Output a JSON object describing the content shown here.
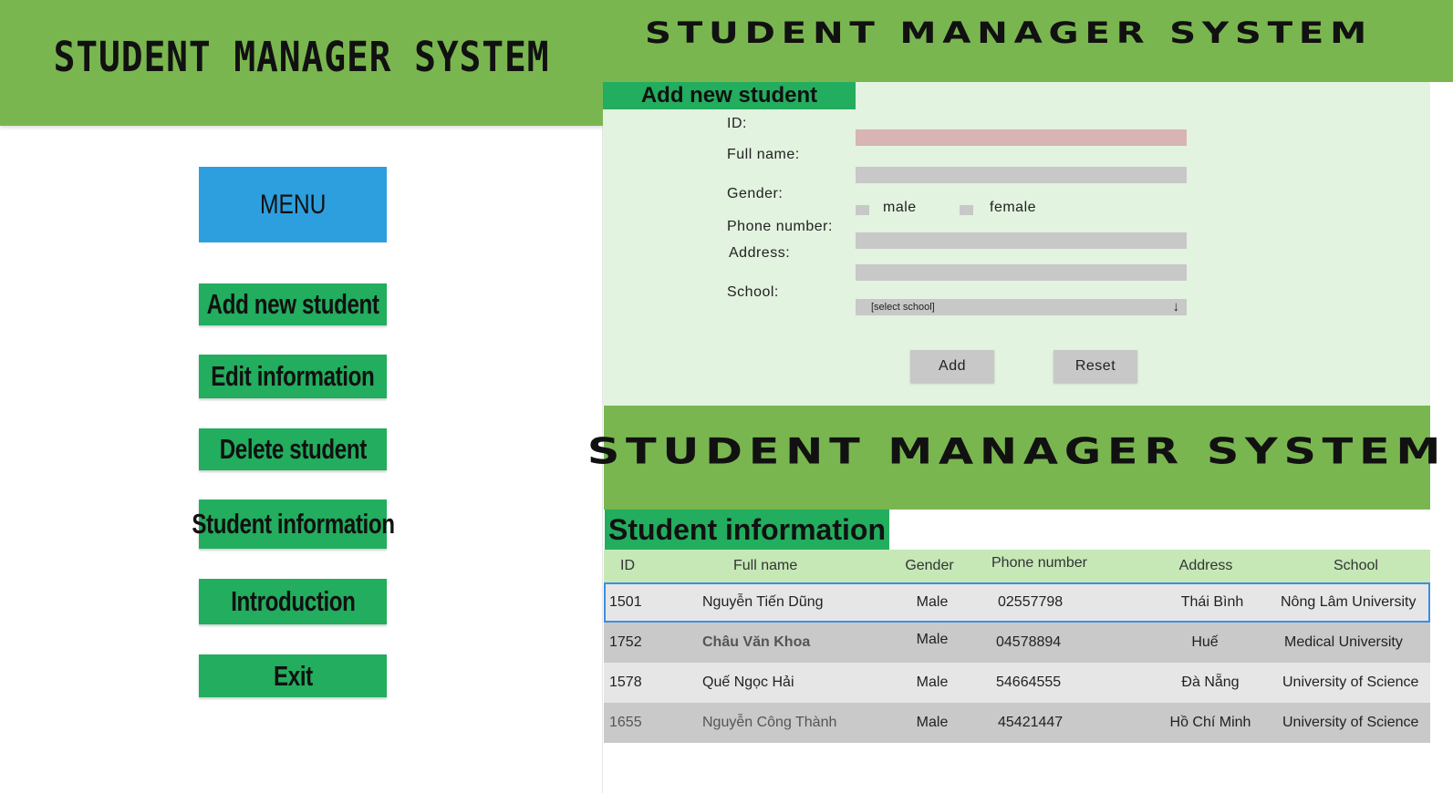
{
  "left": {
    "title": "STUDENT MANAGER SYSTEM",
    "menu_header": "MENU",
    "menu_items": [
      {
        "label": "Add new student"
      },
      {
        "label": "Edit information"
      },
      {
        "label": "Delete student"
      },
      {
        "label": "Student information"
      },
      {
        "label": "Introduction"
      },
      {
        "label": "Exit"
      }
    ]
  },
  "add_panel": {
    "title": "STUDENT MANAGER SYSTEM",
    "tab_label": "Add new student",
    "labels": {
      "id": "ID:",
      "full_name": "Full name:",
      "gender": "Gender:",
      "phone": "Phone number:",
      "address": "Address:",
      "school": "School:"
    },
    "gender_options": [
      "male",
      "female"
    ],
    "school_selected": "[select school]",
    "school_arrow": "↓",
    "add_button": "Add",
    "reset_button": "Reset"
  },
  "info_panel": {
    "title": "STUDENT MANAGER SYSTEM",
    "tab_label": "Student information",
    "columns": [
      "ID",
      "Full name",
      "Gender",
      "Phone number",
      "Address",
      "School"
    ],
    "rows": [
      {
        "id": "1501",
        "name": "Nguyễn Tiến Dũng",
        "gender": "Male",
        "phone": "02557798",
        "address": "Thái Bình",
        "school": "Nông Lâm University"
      },
      {
        "id": "1752",
        "name": "Châu Văn Khoa",
        "gender": "Male",
        "phone": "04578894",
        "address": "Huế",
        "school": "Medical University"
      },
      {
        "id": "1578",
        "name": "Quế Ngọc Hải",
        "gender": "Male",
        "phone": "54664555",
        "address": "Đà Nẵng",
        "school": "University of Science"
      },
      {
        "id": "1655",
        "name": "Nguyễn Công Thành",
        "gender": "Male",
        "phone": "45421447",
        "address": "Hồ Chí Minh",
        "school": "University of Science"
      }
    ]
  },
  "colors": {
    "header_green": "#7ab650",
    "button_green": "#23ad5e",
    "menu_blue": "#2d9fde",
    "form_bg": "#e2f3df",
    "selection_blue": "#3d8ee0"
  }
}
